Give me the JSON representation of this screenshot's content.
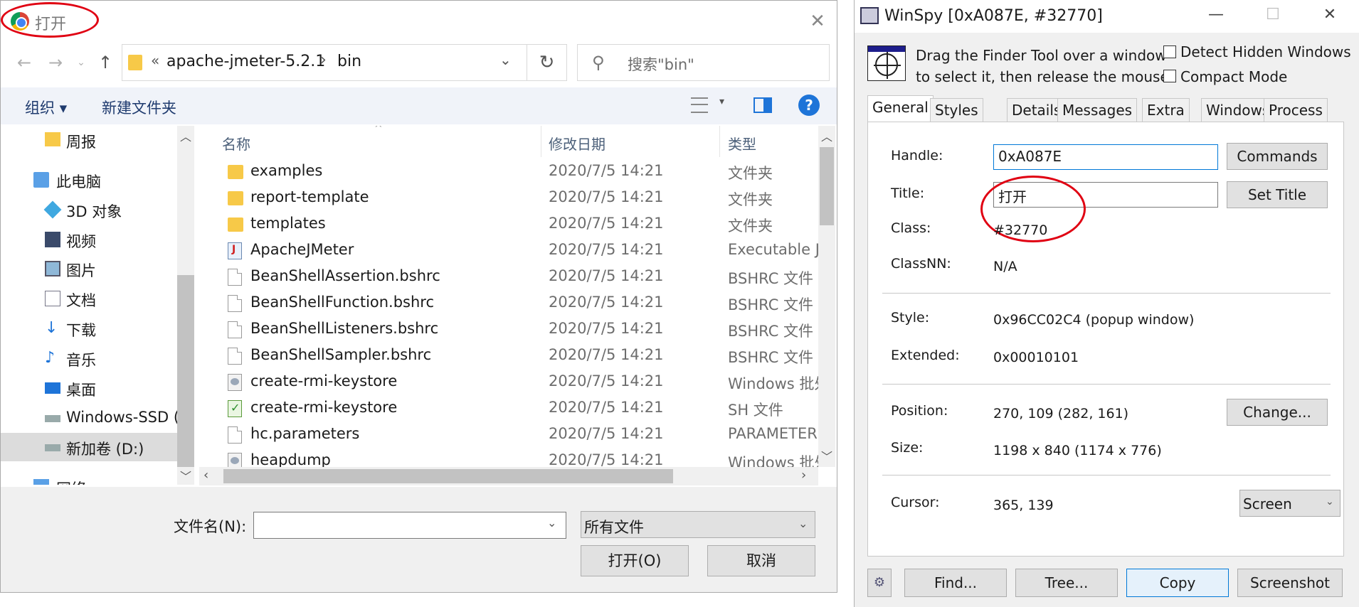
{
  "open_dialog": {
    "title": "打开",
    "close_glyph": "✕",
    "address": {
      "segment1": "apache-jmeter-5.2.1",
      "separator": "›",
      "segment2": "bin",
      "chevron": "«"
    },
    "search_placeholder": "搜索\"bin\"",
    "toolbar": {
      "organize": "组织 ▾",
      "new_folder": "新建文件夹",
      "help": "?"
    },
    "nav_items": [
      {
        "label": "周报",
        "icon": "folder-icon"
      },
      {
        "label": "此电脑",
        "icon": "computer-icon"
      },
      {
        "label": "3D 对象",
        "icon": "3d-objects-icon"
      },
      {
        "label": "视频",
        "icon": "video-icon"
      },
      {
        "label": "图片",
        "icon": "pictures-icon"
      },
      {
        "label": "文档",
        "icon": "documents-icon"
      },
      {
        "label": "下载",
        "icon": "download-icon"
      },
      {
        "label": "音乐",
        "icon": "music-icon"
      },
      {
        "label": "桌面",
        "icon": "desktop-icon"
      },
      {
        "label": "Windows-SSD (",
        "icon": "drive-icon"
      },
      {
        "label": "新加卷 (D:)",
        "icon": "drive-icon"
      },
      {
        "label": "网络",
        "icon": "network-icon"
      }
    ],
    "columns": {
      "name": "名称",
      "date": "修改日期",
      "type": "类型"
    },
    "files": [
      {
        "name": "examples",
        "date": "2020/7/5 14:21",
        "type": "文件夹",
        "icon": "folder"
      },
      {
        "name": "report-template",
        "date": "2020/7/5 14:21",
        "type": "文件夹",
        "icon": "folder"
      },
      {
        "name": "templates",
        "date": "2020/7/5 14:21",
        "type": "文件夹",
        "icon": "folder"
      },
      {
        "name": "ApacheJMeter",
        "date": "2020/7/5 14:21",
        "type": "Executable Ja",
        "icon": "java"
      },
      {
        "name": "BeanShellAssertion.bshrc",
        "date": "2020/7/5 14:21",
        "type": "BSHRC 文件",
        "icon": "doc"
      },
      {
        "name": "BeanShellFunction.bshrc",
        "date": "2020/7/5 14:21",
        "type": "BSHRC 文件",
        "icon": "doc"
      },
      {
        "name": "BeanShellListeners.bshrc",
        "date": "2020/7/5 14:21",
        "type": "BSHRC 文件",
        "icon": "doc"
      },
      {
        "name": "BeanShellSampler.bshrc",
        "date": "2020/7/5 14:21",
        "type": "BSHRC 文件",
        "icon": "doc"
      },
      {
        "name": "create-rmi-keystore",
        "date": "2020/7/5 14:21",
        "type": "Windows 批处",
        "icon": "bat"
      },
      {
        "name": "create-rmi-keystore",
        "date": "2020/7/5 14:21",
        "type": "SH 文件",
        "icon": "sh"
      },
      {
        "name": "hc.parameters",
        "date": "2020/7/5 14:21",
        "type": "PARAMETERS",
        "icon": "doc"
      },
      {
        "name": "heapdump",
        "date": "2020/7/5 14:21",
        "type": "Windows 批处",
        "icon": "bat"
      }
    ],
    "filename_label": "文件名(N):",
    "filename_value": "",
    "filter_value": "所有文件",
    "open_button": "打开(O)",
    "cancel_button": "取消"
  },
  "winspy": {
    "title": "WinSpy [0xA087E, #32770]",
    "window_controls": {
      "minimize": "—",
      "maximize": "☐",
      "close": "✕"
    },
    "instructions_line1": "Drag the Finder Tool over a window",
    "instructions_line2": "to select it, then release the mouse",
    "detect_hidden": "Detect Hidden Windows",
    "compact_mode": "Compact Mode",
    "tabs": [
      "General",
      "Styles",
      "Details",
      "Messages",
      "Extra",
      "Windows",
      "Process"
    ],
    "active_tab": "General",
    "handle_label": "Handle:",
    "handle_value": "0xA087E",
    "title_label": "Title:",
    "title_value": "打开",
    "class_label": "Class:",
    "class_value": "#32770",
    "classnn_label": "ClassNN:",
    "classnn_value": "N/A",
    "style_label": "Style:",
    "style_value": "0x96CC02C4 (popup window)",
    "extended_label": "Extended:",
    "extended_value": "0x00010101",
    "position_label": "Position:",
    "position_value": "270, 109 (282, 161)",
    "size_label": "Size:",
    "size_value": "1198 x 840 (1174 x 776)",
    "cursor_label": "Cursor:",
    "cursor_value": "365, 139",
    "commands_button": "Commands",
    "set_title_button": "Set Title",
    "change_button": "Change...",
    "screen_select": "Screen",
    "bottom_buttons": {
      "find": "Find...",
      "tree": "Tree...",
      "copy": "Copy",
      "screenshot": "Screenshot"
    }
  },
  "colors": {
    "annotation_red": "#e00012",
    "accent_blue": "#0078d7",
    "folder_yellow": "#f7c948"
  }
}
